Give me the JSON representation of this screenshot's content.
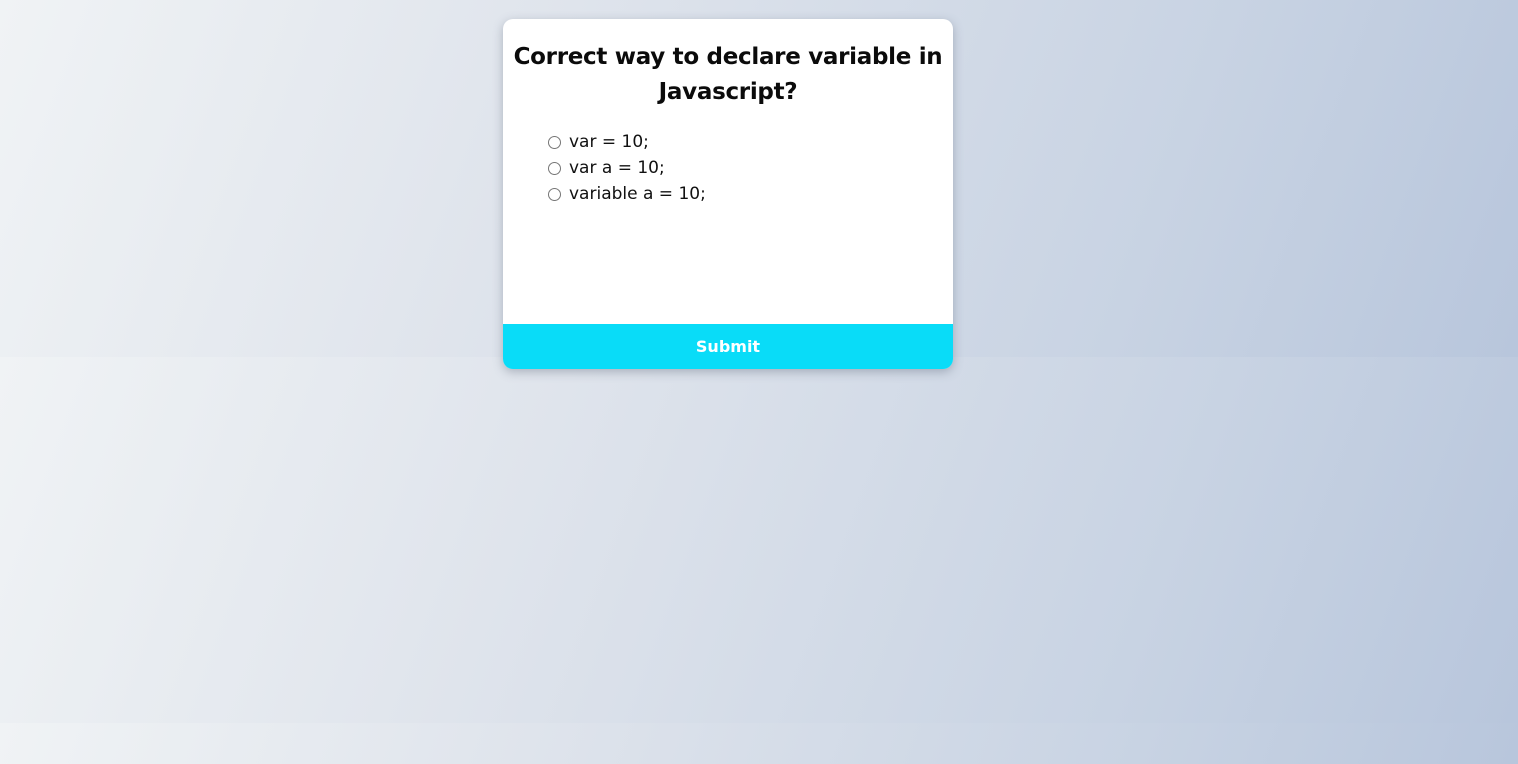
{
  "quiz": {
    "question": "Correct way to declare variable in Javascript?",
    "answers": [
      {
        "label": "var = 10;"
      },
      {
        "label": "var a = 10;"
      },
      {
        "label": "variable a = 10;"
      }
    ],
    "submit_label": "Submit"
  },
  "colors": {
    "accent": "#09dcf8",
    "card": "#ffffff",
    "background_start": "#f0f3f5",
    "background_end": "#b8c6dc"
  }
}
